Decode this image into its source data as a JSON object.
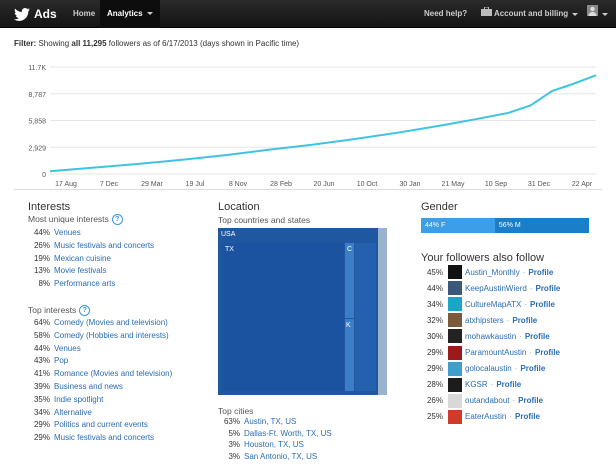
{
  "nav": {
    "brand": "Ads",
    "home": "Home",
    "analytics": "Analytics",
    "help": "Need help?",
    "account": "Account and billing"
  },
  "filter": {
    "label": "Filter:",
    "text_before": "Showing",
    "bold": "all 11,295",
    "text_after": "followers as of 6/17/2013 (days shown in Pacific time)"
  },
  "chart_data": {
    "type": "line",
    "color": "#3ec3e3",
    "y_ticks": [
      "0",
      "2,929",
      "5,858",
      "8,787",
      "11.7K"
    ],
    "ylim": [
      0,
      11716
    ],
    "x_ticks": [
      "17 Aug",
      "7 Dec",
      "29 Mar",
      "19 Jul",
      "8 Nov",
      "28 Feb",
      "20 Jun",
      "10 Oct",
      "30 Jan",
      "21 May",
      "10 Sep",
      "31 Dec",
      "22 Apr"
    ],
    "x": [
      0,
      0.08,
      0.16,
      0.24,
      0.32,
      0.4,
      0.48,
      0.56,
      0.64,
      0.72,
      0.78,
      0.84,
      0.88,
      0.9,
      0.92,
      0.955,
      1.0
    ],
    "values": [
      300,
      700,
      1100,
      1550,
      2050,
      2650,
      3200,
      3850,
      4550,
      5350,
      6000,
      6700,
      7500,
      8300,
      9100,
      9800,
      10800
    ]
  },
  "interests": {
    "title": "Interests",
    "unique_title": "Most unique interests",
    "unique": [
      {
        "pct": "44%",
        "label": "Venues"
      },
      {
        "pct": "26%",
        "label": "Music festivals and concerts"
      },
      {
        "pct": "19%",
        "label": "Mexican cuisine"
      },
      {
        "pct": "13%",
        "label": "Movie festivals"
      },
      {
        "pct": "8%",
        "label": "Performance arts"
      }
    ],
    "top_title": "Top interests",
    "top": [
      {
        "pct": "64%",
        "label": "Comedy (Movies and television)"
      },
      {
        "pct": "58%",
        "label": "Comedy (Hobbies and interests)"
      },
      {
        "pct": "44%",
        "label": "Venues"
      },
      {
        "pct": "43%",
        "label": "Pop"
      },
      {
        "pct": "41%",
        "label": "Romance (Movies and television)"
      },
      {
        "pct": "39%",
        "label": "Business and news"
      },
      {
        "pct": "35%",
        "label": "Indie spotlight"
      },
      {
        "pct": "34%",
        "label": "Alternative"
      },
      {
        "pct": "29%",
        "label": "Politics and current events"
      },
      {
        "pct": "29%",
        "label": "Music festivals and concerts"
      }
    ]
  },
  "location": {
    "title": "Location",
    "countries_title": "Top countries and states",
    "map_labels": {
      "usa": "USA",
      "tx": "TX",
      "c": "C",
      "k": "K"
    },
    "cities_title": "Top cities",
    "cities": [
      {
        "pct": "63%",
        "label": "Austin, TX, US"
      },
      {
        "pct": "5%",
        "label": "Dallas-Ft. Worth, TX, US"
      },
      {
        "pct": "3%",
        "label": "Houston, TX, US"
      },
      {
        "pct": "3%",
        "label": "San Antonio, TX, US"
      }
    ]
  },
  "gender": {
    "title": "Gender",
    "female_label": "44% F",
    "male_label": "56% M",
    "female_frac": 0.44,
    "male_frac": 0.56
  },
  "follow": {
    "title": "Your followers also follow",
    "profile_label": "Profile",
    "accounts": [
      {
        "pct": "45%",
        "name": "Austin_Monthly",
        "color": "#111111"
      },
      {
        "pct": "44%",
        "name": "KeepAustinWierd",
        "color": "#3b5a7a"
      },
      {
        "pct": "34%",
        "name": "CultureMapATX",
        "color": "#19a6c7"
      },
      {
        "pct": "32%",
        "name": "atxhipsters",
        "color": "#7a5a3a"
      },
      {
        "pct": "30%",
        "name": "mohawkaustin",
        "color": "#222222"
      },
      {
        "pct": "29%",
        "name": "ParamountAustin",
        "color": "#9b1b1b"
      },
      {
        "pct": "29%",
        "name": "golocalaustin",
        "color": "#3e9fcf"
      },
      {
        "pct": "28%",
        "name": "KGSR",
        "color": "#1c1c1c"
      },
      {
        "pct": "26%",
        "name": "outandabout",
        "color": "#d8d8d8"
      },
      {
        "pct": "25%",
        "name": "EaterAustin",
        "color": "#d03a2a"
      }
    ]
  }
}
